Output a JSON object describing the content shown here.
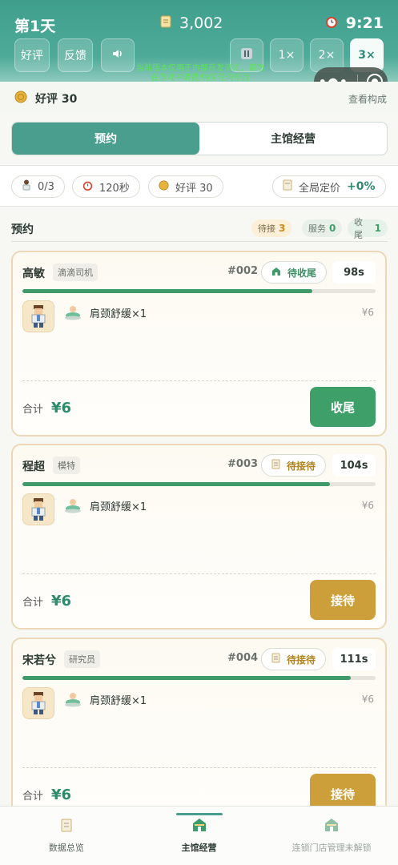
{
  "header": {
    "day": "第1天",
    "money": "3,002",
    "time": "9:21",
    "buttons": {
      "review": "好评",
      "feedback": "反馈"
    },
    "speeds": [
      "1×",
      "2×",
      "3×"
    ],
    "notice": "当前版本仅用于内部开发测试，请勿在游戏中消费/购买任何东西"
  },
  "reputation": {
    "label": "好评 30",
    "link": "查看构成"
  },
  "tabs": [
    "预约",
    "主馆经营"
  ],
  "stats": {
    "staff": "0/3",
    "duration": "120秒",
    "reputation": "好评 30",
    "pricing_label": "全局定价",
    "pricing_value": "+0%"
  },
  "section": {
    "title": "预约",
    "pending_label": "待接",
    "pending_count": "3",
    "serving_label": "服务",
    "serving_count": "0",
    "closing_label": "收尾",
    "closing_count": "1"
  },
  "cards": [
    {
      "name": "高敏",
      "role": "滴滴司机",
      "number": "#002",
      "status": "待收尾",
      "timer": "98s",
      "progress": 0.82,
      "service": "肩颈舒缓×1",
      "price": "¥6",
      "total_label": "合计",
      "total": "¥6",
      "action": "收尾"
    },
    {
      "name": "程超",
      "role": "模特",
      "number": "#003",
      "status": "待接待",
      "timer": "104s",
      "progress": 0.87,
      "service": "肩颈舒缓×1",
      "price": "¥6",
      "total_label": "合计",
      "total": "¥6",
      "action": "接待"
    },
    {
      "name": "宋若兮",
      "role": "研究员",
      "number": "#004",
      "status": "待接待",
      "timer": "111s",
      "progress": 0.93,
      "service": "肩颈舒缓×1",
      "price": "¥6",
      "total_label": "合计",
      "total": "¥6",
      "action": "接待"
    }
  ],
  "bottom_nav": [
    "数据总览",
    "主馆经营",
    "连锁门店管理未解锁"
  ],
  "colors": {
    "primary": "#4a9e8e",
    "accent_green": "#3f9f68",
    "gold": "#cc9f3a",
    "card_border": "#ecd8b8"
  }
}
